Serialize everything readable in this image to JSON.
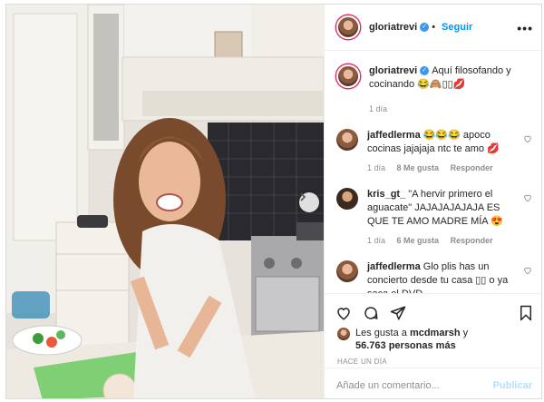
{
  "header": {
    "username": "gloriatrevi",
    "follow_label": "Seguir",
    "more_label": "•••"
  },
  "caption": {
    "username": "gloriatrevi",
    "text": "Aquí filosofando y cocinando 😂🙈▯▯💋",
    "time": "1 día"
  },
  "comments": [
    {
      "username": "jaffedlerma",
      "text": "😂😂😂 apoco cocinas jajajaja ntc te amo 💋",
      "time": "1 día",
      "likes": "8 Me gusta",
      "reply": "Responder"
    },
    {
      "username": "kris_gt_",
      "text": "\"A hervir primero el aguacate\" JAJAJAJAJAJA ES QUE TE AMO MADRE MÍA 😍",
      "time": "1 día",
      "likes": "6 Me gusta",
      "reply": "Responder"
    },
    {
      "username": "jaffedlerma",
      "text": "Glo plis has un concierto desde tu casa ▯▯ o ya saca el DVD",
      "time": "",
      "likes": "",
      "reply": ""
    }
  ],
  "likes": {
    "prefix": "Les gusta a",
    "user": "mcdmarsh",
    "conj": "y",
    "count": "56.763 personas más"
  },
  "posted_ago": "HACE UN DÍA",
  "comment_box": {
    "placeholder": "Añade un comentario...",
    "publish_label": "Publicar"
  },
  "icons": [
    "heart-icon",
    "comment-icon",
    "share-icon",
    "bookmark-icon",
    "chevron-right-icon",
    "verified-icon"
  ],
  "colors": {
    "link": "#0095f6",
    "verified": "#3897f0",
    "muted": "#8e8e8e",
    "publish_disabled": "#b2dffc"
  }
}
